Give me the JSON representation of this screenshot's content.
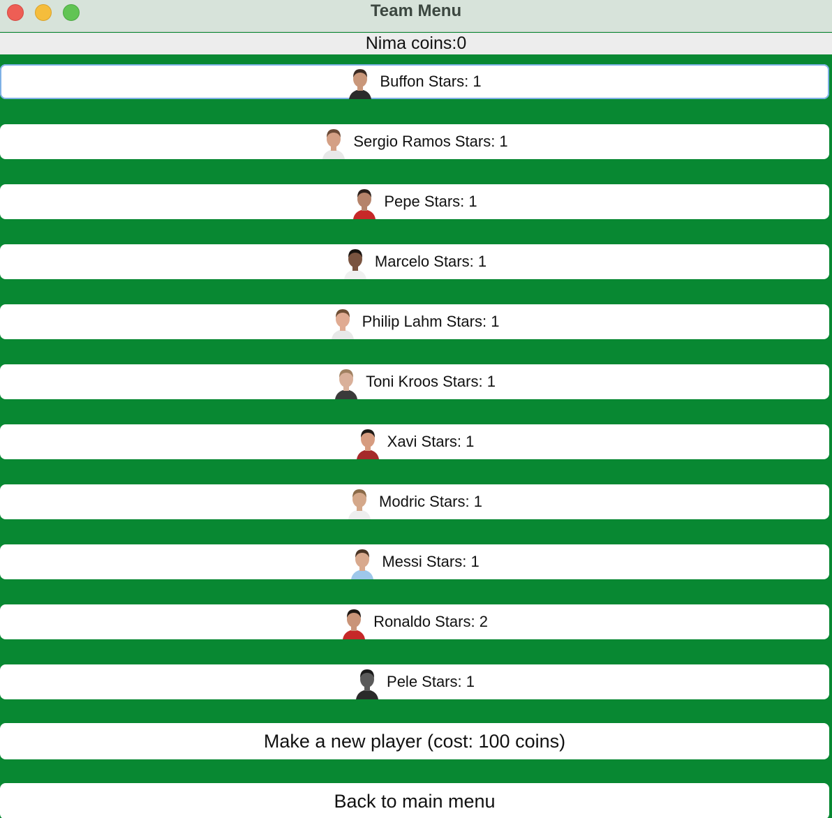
{
  "window": {
    "title": "Team Menu"
  },
  "header": {
    "coins_text": "Nima coins:0"
  },
  "players": [
    {
      "label": "Buffon Stars: 1",
      "skin": "#c9977a",
      "hair": "#3a2a22",
      "shirt": "#2b2b2b",
      "focused": true
    },
    {
      "label": "Sergio Ramos Stars: 1",
      "skin": "#d4a085",
      "hair": "#6b4a36",
      "shirt": "#e8e8e8",
      "focused": false
    },
    {
      "label": "Pepe Stars: 1",
      "skin": "#b5836a",
      "hair": "#2b1f1a",
      "shirt": "#c62828",
      "focused": false
    },
    {
      "label": "Marcelo Stars: 1",
      "skin": "#7a5440",
      "hair": "#1a1410",
      "shirt": "#f0f0f0",
      "focused": false
    },
    {
      "label": "Philip Lahm Stars: 1",
      "skin": "#e0ab92",
      "hair": "#6e4e34",
      "shirt": "#e8e8e8",
      "focused": false
    },
    {
      "label": "Toni Kroos Stars: 1",
      "skin": "#d9b09a",
      "hair": "#a08060",
      "shirt": "#3a3a3a",
      "focused": false
    },
    {
      "label": "Xavi Stars: 1",
      "skin": "#d69c80",
      "hair": "#1f1a16",
      "shirt": "#a52a2a",
      "focused": false
    },
    {
      "label": "Modric Stars: 1",
      "skin": "#d4a88a",
      "hair": "#8a6a48",
      "shirt": "#eeeeee",
      "focused": false
    },
    {
      "label": "Messi Stars: 1",
      "skin": "#d8a98d",
      "hair": "#4a3424",
      "shirt": "#9ec7ea",
      "focused": false
    },
    {
      "label": "Ronaldo Stars: 2",
      "skin": "#c99478",
      "hair": "#1e1712",
      "shirt": "#c62828",
      "focused": false
    },
    {
      "label": "Pele Stars: 1",
      "skin": "#5a5a5a",
      "hair": "#1a1a1a",
      "shirt": "#2a2a2a",
      "focused": false
    }
  ],
  "actions": {
    "new_player": "Make a new player (cost: 100 coins)",
    "back": "Back to main menu"
  }
}
